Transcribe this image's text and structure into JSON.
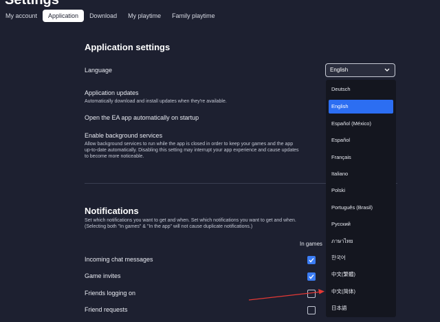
{
  "header": {
    "title": "Settings"
  },
  "tabs": [
    {
      "label": "My account",
      "active": false
    },
    {
      "label": "Application",
      "active": true
    },
    {
      "label": "Download",
      "active": false
    },
    {
      "label": "My playtime",
      "active": false
    },
    {
      "label": "Family playtime",
      "active": false
    }
  ],
  "app_settings": {
    "title": "Application settings",
    "language_label": "Language",
    "language_value": "English",
    "updates_label": "Application updates",
    "updates_desc": "Automatically download and install updates when they're available.",
    "startup_label": "Open the EA app automatically on startup",
    "background_label": "Enable background services",
    "background_desc": "Allow background services to run while the app is closed in order to keep your games and the app up-to-date automatically. Disabling this setting may interrupt your app experience and cause updates to become more noticeable."
  },
  "language_options": [
    "Deutsch",
    "English",
    "Español (México)",
    "Español",
    "Français",
    "Italiano",
    "Polski",
    "Português (Brasil)",
    "Русский",
    "ภาษาไทย",
    "한국어",
    "中文(繁體)",
    "中文(简体)",
    "日本語"
  ],
  "language_selected": "English",
  "notifications": {
    "title": "Notifications",
    "desc": "Set which notifications you want to get and when. Set which notifications you want to get and when. (Selecting both \"In games\" & \"In the app\" will not cause duplicate notifications.)",
    "column_in_games": "In games",
    "items": [
      {
        "label": "Incoming chat messages",
        "in_games": true
      },
      {
        "label": "Game invites",
        "in_games": true
      },
      {
        "label": "Friends logging on",
        "in_games": false
      },
      {
        "label": "Friend requests",
        "in_games": false
      }
    ]
  },
  "colors": {
    "background": "#1d2030",
    "accent": "#2c6ef2",
    "annotation_arrow": "#e53935"
  }
}
